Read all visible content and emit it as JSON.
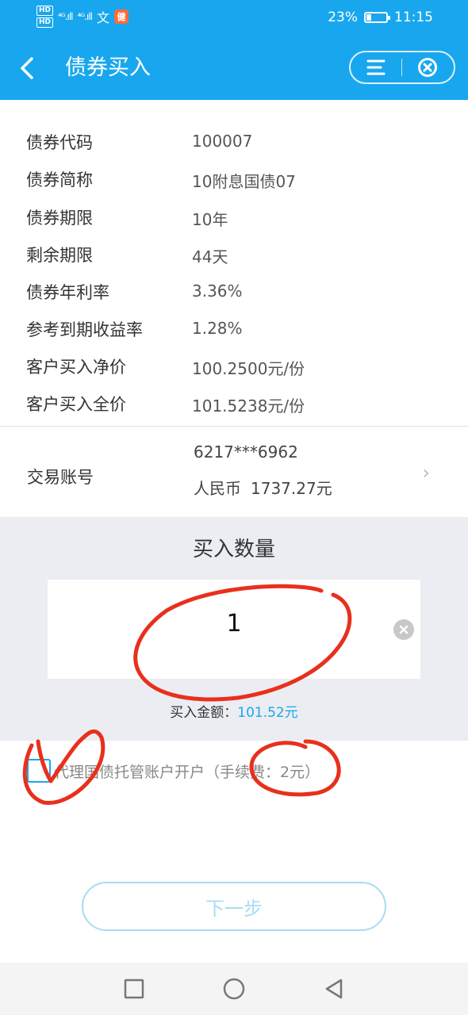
{
  "status_bar": {
    "hd_top": "HD",
    "hd_bottom": "HD",
    "signal_1": "⁴ᴳ.ıll",
    "signal_2": "⁴ᴳ.ıll",
    "wechat_glyph": "文",
    "app_badge": "健",
    "battery_text": "23%",
    "battery_level": 0.23,
    "time": "11:15"
  },
  "nav": {
    "back_glyph": "‹",
    "title": "债券买入"
  },
  "info": [
    {
      "label": "债券代码",
      "value": "100007"
    },
    {
      "label": "债券简称",
      "value": "10附息国债07"
    },
    {
      "label": "债券期限",
      "value": "10年"
    },
    {
      "label": "剩余期限",
      "value": "44天"
    },
    {
      "label": "债券年利率",
      "value": "3.36%"
    },
    {
      "label": "参考到期收益率",
      "value": "1.28%"
    },
    {
      "label": "客户买入净价",
      "value": "100.2500元/份"
    },
    {
      "label": "客户买入全价",
      "value": "101.5238元/份"
    }
  ],
  "account": {
    "label": "交易账号",
    "number": "6217***6962",
    "currency": "人民币",
    "balance": "1737.27元",
    "chevron": "›"
  },
  "quantity": {
    "title": "买入数量",
    "value": "1",
    "amount_label": "买入金额：",
    "amount_value": "101.52元"
  },
  "agreement": {
    "text": "代理国债托管账户开户（手续费：2元）"
  },
  "next_button": {
    "label": "下一步"
  },
  "colors": {
    "primary": "#18a7ee",
    "button_disabled": "#a8dcf5",
    "annotation": "#e8301c"
  }
}
